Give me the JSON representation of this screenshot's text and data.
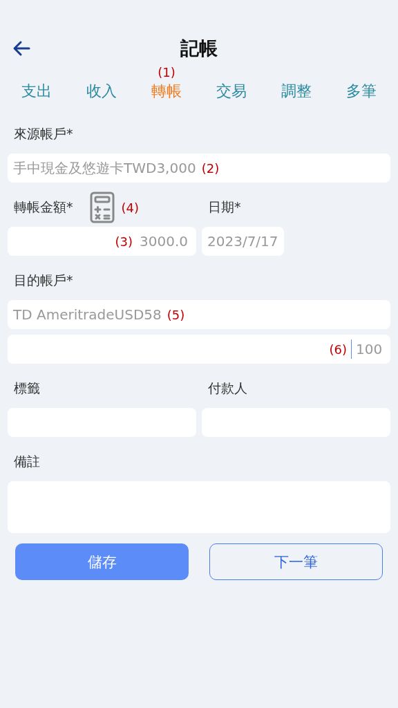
{
  "header": {
    "title": "記帳"
  },
  "tabs": [
    {
      "label": "支出",
      "selected": false
    },
    {
      "label": "收入",
      "selected": false
    },
    {
      "label": "轉帳",
      "selected": true,
      "annotation": "(1)"
    },
    {
      "label": "交易",
      "selected": false
    },
    {
      "label": "調整",
      "selected": false
    },
    {
      "label": "多筆",
      "selected": false
    }
  ],
  "rows": [
    [
      {
        "kind": "label",
        "text": "來源帳戶*"
      }
    ],
    [
      {
        "kind": "select",
        "value": "手中現金及悠遊卡TWD3,000",
        "annotation": "(2)"
      }
    ],
    [
      {
        "kind": "label",
        "text": "轉帳金額*",
        "tool": {
          "kind": "calculator",
          "annotation": "(4)"
        }
      },
      {
        "kind": "label",
        "text": "日期*"
      }
    ],
    [
      {
        "kind": "number",
        "placeholder": "3000.0",
        "annotation": "(3)",
        "focused": false
      },
      {
        "kind": "date",
        "value": "2023/7/17"
      }
    ],
    [
      {
        "kind": "label",
        "text": "目的帳戶*"
      }
    ],
    [
      {
        "kind": "select",
        "value": "TD AmeritradeUSD58",
        "annotation": "(5)"
      }
    ],
    [
      {
        "kind": "number",
        "placeholder": "100",
        "annotation": "(6)",
        "focused": true
      }
    ],
    [
      {
        "kind": "label",
        "text": "標籤"
      },
      {
        "kind": "label",
        "text": "付款人"
      }
    ],
    [
      {
        "kind": "text"
      },
      {
        "kind": "text"
      }
    ],
    [
      {
        "kind": "label",
        "text": "備註"
      }
    ],
    [
      {
        "kind": "textarea"
      }
    ]
  ],
  "buttons": [
    {
      "label": "儲存",
      "kind": "primary"
    },
    {
      "label": "下一筆",
      "kind": "outline"
    }
  ]
}
